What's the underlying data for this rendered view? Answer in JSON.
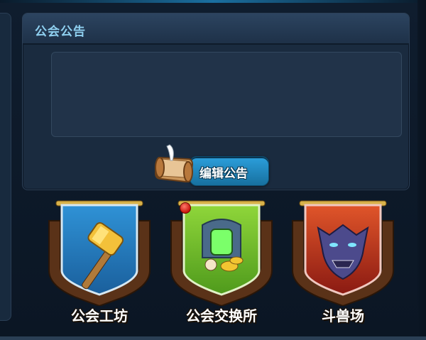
{
  "notice": {
    "title": "公会公告",
    "content": ""
  },
  "edit_button": {
    "label": "编辑公告",
    "icon": "scroll-quill-icon"
  },
  "facilities": [
    {
      "label": "公会工坊",
      "icon": "hammer-icon",
      "banner_color": "#2a86c8",
      "notification": false
    },
    {
      "label": "公会交换所",
      "icon": "treasure-shrine-icon",
      "banner_color": "#6fbf2e",
      "notification": true
    },
    {
      "label": "斗兽场",
      "icon": "beast-face-icon",
      "banner_color": "#c8281e",
      "notification": false
    }
  ],
  "colors": {
    "title_text": "#8fd0f0",
    "button_blue": "#2c9fdc",
    "notification_red": "#d21a10"
  }
}
